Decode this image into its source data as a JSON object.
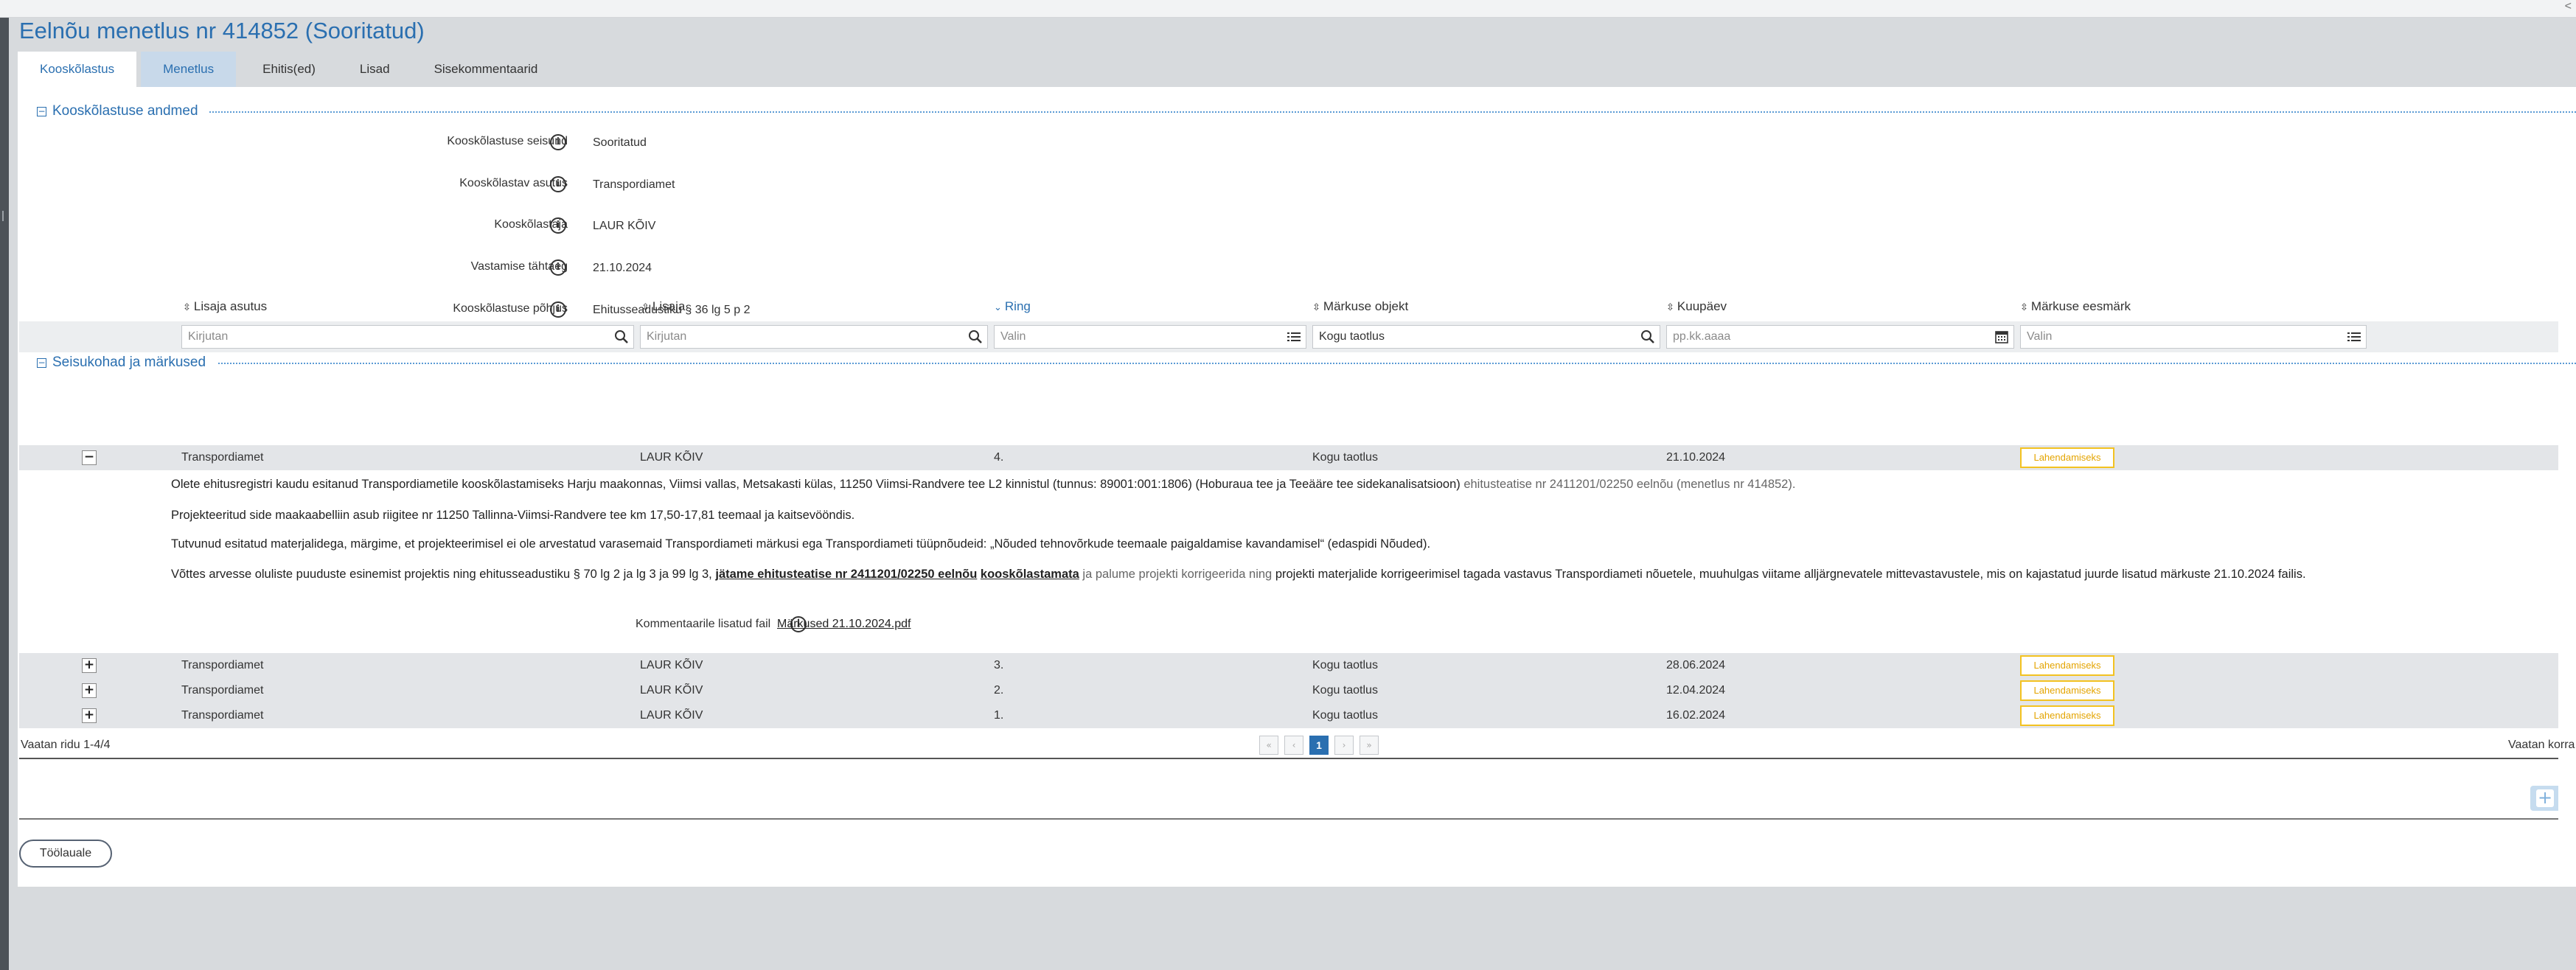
{
  "window": {
    "corner_glyph": "<"
  },
  "page_title": "Eelnõu menetlus nr 414852 (Sooritatud)",
  "tabs": [
    "Kooskõlastus",
    "Menetlus",
    "Ehitis(ed)",
    "Lisad",
    "Sisekommentaarid"
  ],
  "section1": {
    "title": "Kooskõlastuse andmed",
    "toggle": "−",
    "fields": [
      {
        "label": "Kooskõlastuse seisund",
        "value": "Sooritatud"
      },
      {
        "label": "Kooskõlastav asutus",
        "value": "Transpordiamet"
      },
      {
        "label": "Kooskõlastaja",
        "value": "LAUR KÕIV"
      },
      {
        "label": "Vastamise tähtaeg",
        "value": "21.10.2024"
      },
      {
        "label": "Kooskõlastuse põhjus",
        "value": "Ehitusseadustiku § 36 lg 5 p 2"
      }
    ]
  },
  "section2": {
    "title": "Seisukohad ja märkused",
    "toggle": "−",
    "columns": [
      "Lisaja asutus",
      "Lisaja",
      "Ring",
      "Märkuse objekt",
      "Kuupäev",
      "Märkuse eesmärk"
    ],
    "filters": [
      "Kirjutan",
      "Kirjutan",
      "Valin",
      "Kogu taotlus",
      "pp.kk.aaaa",
      "Valin"
    ],
    "rows": [
      {
        "toggle": "−",
        "org": "Transpordiamet",
        "author": "LAUR KÕIV",
        "ring": "4.",
        "object": "Kogu taotlus",
        "date": "21.10.2024",
        "purpose": "Lahendamiseks"
      },
      {
        "toggle": "+",
        "org": "Transpordiamet",
        "author": "LAUR KÕIV",
        "ring": "3.",
        "object": "Kogu taotlus",
        "date": "28.06.2024",
        "purpose": "Lahendamiseks"
      },
      {
        "toggle": "+",
        "org": "Transpordiamet",
        "author": "LAUR KÕIV",
        "ring": "2.",
        "object": "Kogu taotlus",
        "date": "12.04.2024",
        "purpose": "Lahendamiseks"
      },
      {
        "toggle": "+",
        "org": "Transpordiamet",
        "author": "LAUR KÕIV",
        "ring": "1.",
        "object": "Kogu taotlus",
        "date": "16.02.2024",
        "purpose": "Lahendamiseks"
      }
    ],
    "detail": {
      "p1_a": "Olete ehitusregistri kaudu esitanud Transpordiametile kooskõlastamiseks Harju maakonnas, Viimsi vallas, Metsakasti külas, 11250 Viimsi-Randvere tee L2 kinnistul (tunnus: 89001:001:1806) (Hoburaua tee ja Teeääre tee sidekanalisatsioon)",
      "p1_b": "ehitusteatise nr 2411201/02250 eelnõu (menetlus nr 414852).",
      "p2": "Projekteeritud side maakaabelliin asub riigitee nr 11250 Tallinna-Viimsi-Randvere tee km 17,50-17,81 teemaal ja kaitsevööndis.",
      "p3": "Tutvunud esitatud materjalidega, märgime, et projekteerimisel ei ole arvestatud varasemaid Transpordiameti märkusi ega Transpordiameti tüüpnõudeid: „Nõuded tehnovõrkude teemaale paigaldamise kavandamisel“ (edaspidi Nõuded).",
      "p4_a": "Võttes arvesse oluliste puuduste esinemist projektis ning ehitusseadustiku § 70 lg 2 ja lg 3 ja 99 lg 3,",
      "p4_link": "jätame ehitusteatise nr 2411201/02250 eelnõu",
      "p4_bold": "kooskõlastamata",
      "p4_muted": "ja palume projekti korrigeerida ning",
      "p4_c": "projekti materjalide korrigeerimisel tagada vastavus Transpordiameti nõuetele, muuhulgas viitame alljärgnevatele mittevastavustele, mis on kajastatud juurde lisatud märkuste 21.10.2024 failis.",
      "file_label": "Kommentaarile lisatud fail",
      "file_name": "Märkused 21.10.2024.pdf"
    },
    "pager": {
      "left_text": "Vaatan ridu 1-4/4",
      "first": "«",
      "prev": "‹",
      "current": "1",
      "next": "›",
      "last": "»",
      "right_text": "Vaatan korra"
    },
    "add_glyph": "+"
  },
  "back_button": "Töölauale",
  "colors": {
    "accent": "#2a6fb0",
    "badge": "#f3c221"
  }
}
